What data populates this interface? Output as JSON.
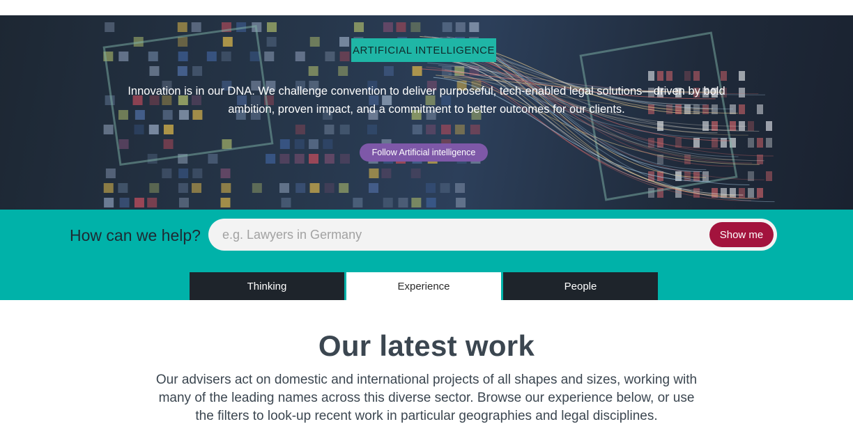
{
  "hero": {
    "tag": "ARTIFICIAL INTELLIGENCE",
    "description": "Innovation is in our DNA. We challenge convention to deliver purposeful, tech-enabled legal solutions—driven by bold ambition, proven impact, and a commitment to better outcomes for our clients.",
    "follow_button": "Follow Artificial intelligence"
  },
  "search": {
    "label": "How can we help?",
    "placeholder": "e.g. Lawyers in Germany",
    "value": "",
    "button": "Show me"
  },
  "tabs": [
    {
      "label": "Thinking",
      "active": false
    },
    {
      "label": "Experience",
      "active": true
    },
    {
      "label": "People",
      "active": false
    }
  ],
  "latest": {
    "title": "Our latest work",
    "description": "Our advisers act on domestic and international projects of all shapes and sizes, working with many of the leading names across this diverse sector. Browse our experience below, or use the filters to look-up recent work in particular geographies and legal disciplines."
  },
  "colors": {
    "teal": "#00b2a9",
    "tag_teal": "#1fb6a6",
    "purple": "#7e58a8",
    "crimson": "#a3133d",
    "tab_dark": "#1e242b",
    "heading": "#3b4650"
  }
}
